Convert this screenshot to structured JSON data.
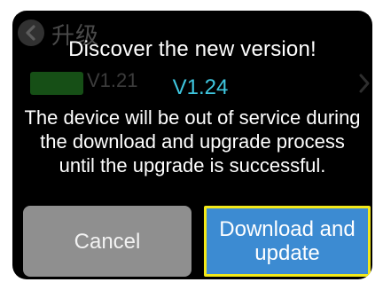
{
  "background_screen": {
    "title": "升级",
    "current_version": "V1.21"
  },
  "dialog": {
    "heading": "Discover the new version!",
    "new_version": "V1.24",
    "message": "The device will be out of service during the download and upgrade process until the upgrade is successful.",
    "cancel_label": "Cancel",
    "download_label": "Download and update"
  },
  "colors": {
    "screen_background": "#000000",
    "version_accent": "#3fc7e0",
    "cancel_button": "#8f8f8f",
    "download_button": "#3c8bd2",
    "focus_outline": "#f2e81a"
  },
  "icons": {
    "back": "back-arrow-icon",
    "chevron": "chevron-right-icon"
  }
}
